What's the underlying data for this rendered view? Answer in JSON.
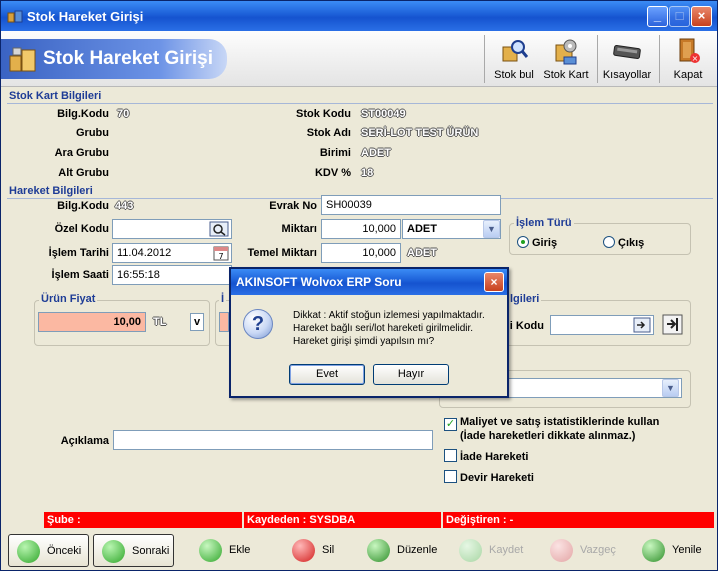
{
  "window": {
    "title": "Stok Hareket Girişi"
  },
  "banner": {
    "title": "Stok Hareket Girişi"
  },
  "toolbar": {
    "stok_bul": "Stok bul",
    "stok_kart": "Stok Kart",
    "kisayollar": "Kısayollar",
    "kapat": "Kapat"
  },
  "stok_kart": {
    "section_title": "Stok Kart Bilgileri",
    "bilg_kodu_label": "Bilg.Kodu",
    "bilg_kodu_value": "70",
    "grubu_label": "Grubu",
    "ara_grubu_label": "Ara Grubu",
    "alt_grubu_label": "Alt Grubu",
    "stok_kodu_label": "Stok Kodu",
    "stok_kodu_value": "ST00049",
    "stok_adi_label": "Stok Adı",
    "stok_adi_value": "SERİ-LOT TEST ÜRÜN",
    "birimi_label": "Birimi",
    "birimi_value": "ADET",
    "kdv_label": "KDV %",
    "kdv_value": "18"
  },
  "hareket": {
    "section_title": "Hareket Bilgileri",
    "bilg_kodu_label": "Bilg.Kodu",
    "bilg_kodu_value": "443",
    "ozel_kodu_label": "Özel Kodu",
    "ozel_kodu_value": "",
    "islem_tarihi_label": "İşlem Tarihi",
    "islem_tarihi_value": "11.04.2012",
    "islem_saati_label": "İşlem Saati",
    "islem_saati_value": "16:55:18",
    "evrak_no_label": "Evrak No",
    "evrak_no_value": "SH00039",
    "miktari_label": "Miktarı",
    "miktari_value": "10,000",
    "miktari_birim": "ADET",
    "temel_miktari_label": "Temel Miktarı",
    "temel_miktari_value": "10,000",
    "temel_birim": "ADET",
    "islem_turu_label": "İşlem Türü",
    "giris_label": "Giriş",
    "cikis_label": "Çıkış",
    "islem_turu_selected": "Giriş"
  },
  "urun_fiyat": {
    "title": "Ürün Fiyat",
    "value": "10,00",
    "currency": "TL",
    "btn": "v"
  },
  "obscured": {
    "panel2_title_fragment": "İ",
    "panel3_title_fragment": "lgileri",
    "kodu_label_fragment": "i Kodu"
  },
  "aciklama": {
    "label": "Açıklama",
    "value": ""
  },
  "checks": {
    "maliyet_line1": "Maliyet ve satış istatistiklerinde kullan",
    "maliyet_line2": "(İade hareketleri dikkate alınmaz.)",
    "maliyet_checked": "✓",
    "iade": "İade Hareketi",
    "devir": "Devir Hareketi"
  },
  "status": {
    "sube": "Şube :",
    "kaydeden": "Kaydeden : SYSDBA",
    "degistiren": "Değiştiren :  -"
  },
  "bottom": {
    "onceki": "Önceki",
    "sonraki": "Sonraki",
    "ekle": "Ekle",
    "sil": "Sil",
    "duzenle": "Düzenle",
    "kaydet": "Kaydet",
    "vazgec": "Vazgeç",
    "yenile": "Yenile"
  },
  "dialog": {
    "title": "AKINSOFT Wolvox ERP Soru",
    "icon": "?",
    "message_lines": [
      "Dikkat : Aktif stoğun izlemesi yapılmaktadır.",
      "Hareket bağlı seri/lot hareketi girilmelidir.",
      "Hareket girişi şimdi yapılsın mı?"
    ],
    "yes": "Evet",
    "no": "Hayır"
  },
  "colors": {
    "title_blue": "#1c5fd8",
    "section_blue": "#1e3c96",
    "price_salmon": "#fbb8a2",
    "status_red": "#ff0000"
  }
}
